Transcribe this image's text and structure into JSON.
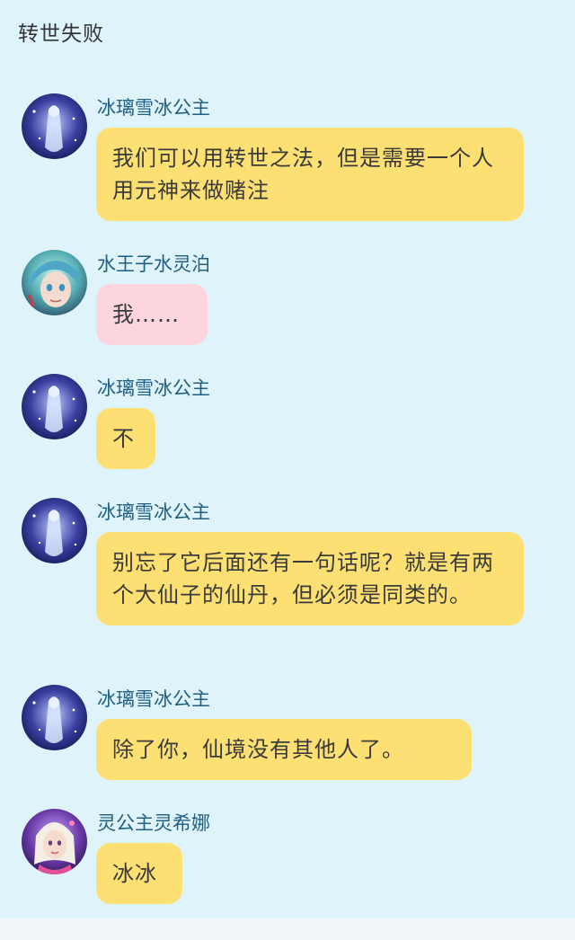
{
  "header": {
    "title": "转世失败"
  },
  "messages": [
    {
      "sender": "冰璃雪冰公主",
      "text": "我们可以用转世之法，但是需要一个人用元神来做赌注",
      "color": "#fde073"
    },
    {
      "sender": "水王子水灵泊",
      "text": "我……",
      "color": "#fdd5df"
    },
    {
      "sender": "冰璃雪冰公主",
      "text": "不",
      "color": "#fde073"
    },
    {
      "sender": "冰璃雪冰公主",
      "text": "别忘了它后面还有一句话呢？就是有两个大仙子的仙丹，但必须是同类的。",
      "color": "#fde073"
    },
    {
      "sender": "冰璃雪冰公主",
      "text": "除了你，仙境没有其他人了。",
      "color": "#fde073"
    },
    {
      "sender": "灵公主灵希娜",
      "text": "冰冰",
      "color": "#fde073"
    }
  ]
}
